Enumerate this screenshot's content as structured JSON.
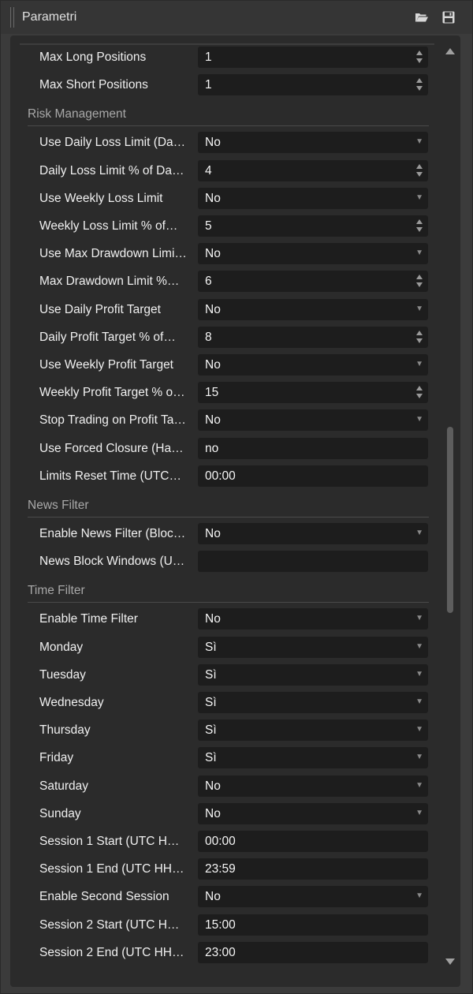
{
  "window": {
    "title": "Parametri",
    "icons": [
      "folder-open-icon",
      "save-icon"
    ]
  },
  "rows": [
    {
      "kind": "param",
      "label": "Max Long Positions",
      "value": "1",
      "control": "spin"
    },
    {
      "kind": "param",
      "label": "Max Short Positions",
      "value": "1",
      "control": "spin"
    },
    {
      "kind": "section",
      "label": "Risk Management"
    },
    {
      "kind": "param",
      "label": "Use Daily Loss Limit (Da…",
      "value": "No",
      "control": "dropdown"
    },
    {
      "kind": "param",
      "label": "Daily Loss Limit % of Da…",
      "value": "4",
      "control": "spin"
    },
    {
      "kind": "param",
      "label": "Use Weekly Loss Limit",
      "value": "No",
      "control": "dropdown"
    },
    {
      "kind": "param",
      "label": "Weekly Loss Limit % of…",
      "value": "5",
      "control": "spin"
    },
    {
      "kind": "param",
      "label": "Use Max Drawdown Limi…",
      "value": "No",
      "control": "dropdown"
    },
    {
      "kind": "param",
      "label": "Max Drawdown Limit %…",
      "value": "6",
      "control": "spin"
    },
    {
      "kind": "param",
      "label": "Use Daily Profit Target",
      "value": "No",
      "control": "dropdown"
    },
    {
      "kind": "param",
      "label": "Daily Profit Target % of…",
      "value": "8",
      "control": "spin"
    },
    {
      "kind": "param",
      "label": "Use Weekly Profit Target",
      "value": "No",
      "control": "dropdown"
    },
    {
      "kind": "param",
      "label": "Weekly Profit Target % o…",
      "value": "15",
      "control": "spin"
    },
    {
      "kind": "param",
      "label": "Stop Trading on Profit Ta…",
      "value": "No",
      "control": "dropdown"
    },
    {
      "kind": "param",
      "label": "Use Forced Closure (Ha…",
      "value": "no",
      "control": "text"
    },
    {
      "kind": "param",
      "label": "Limits Reset Time (UTC…",
      "value": "00:00",
      "control": "text"
    },
    {
      "kind": "section",
      "label": "News Filter"
    },
    {
      "kind": "param",
      "label": "Enable News Filter (Bloc…",
      "value": "No",
      "control": "dropdown"
    },
    {
      "kind": "param",
      "label": "News Block Windows (U…",
      "value": "",
      "control": "text"
    },
    {
      "kind": "section",
      "label": "Time Filter"
    },
    {
      "kind": "param",
      "label": "Enable Time Filter",
      "value": "No",
      "control": "dropdown"
    },
    {
      "kind": "param",
      "label": "Monday",
      "value": "Sì",
      "control": "dropdown"
    },
    {
      "kind": "param",
      "label": "Tuesday",
      "value": "Sì",
      "control": "dropdown"
    },
    {
      "kind": "param",
      "label": "Wednesday",
      "value": "Sì",
      "control": "dropdown"
    },
    {
      "kind": "param",
      "label": "Thursday",
      "value": "Sì",
      "control": "dropdown"
    },
    {
      "kind": "param",
      "label": "Friday",
      "value": "Sì",
      "control": "dropdown"
    },
    {
      "kind": "param",
      "label": "Saturday",
      "value": "No",
      "control": "dropdown"
    },
    {
      "kind": "param",
      "label": "Sunday",
      "value": "No",
      "control": "dropdown"
    },
    {
      "kind": "param",
      "label": "Session 1 Start (UTC H…",
      "value": "00:00",
      "control": "text"
    },
    {
      "kind": "param",
      "label": "Session 1 End (UTC HH…",
      "value": "23:59",
      "control": "text"
    },
    {
      "kind": "param",
      "label": "Enable Second Session",
      "value": "No",
      "control": "dropdown"
    },
    {
      "kind": "param",
      "label": "Session 2 Start (UTC H…",
      "value": "15:00",
      "control": "text"
    },
    {
      "kind": "param",
      "label": "Session 2 End (UTC HH…",
      "value": "23:00",
      "control": "text"
    }
  ],
  "scroll": {
    "position": 0.55
  },
  "colors": {
    "background": "#3b3b3b",
    "panel": "#2b2b2b",
    "field": "#1d1d1d",
    "section_text": "#a8a8a8"
  }
}
